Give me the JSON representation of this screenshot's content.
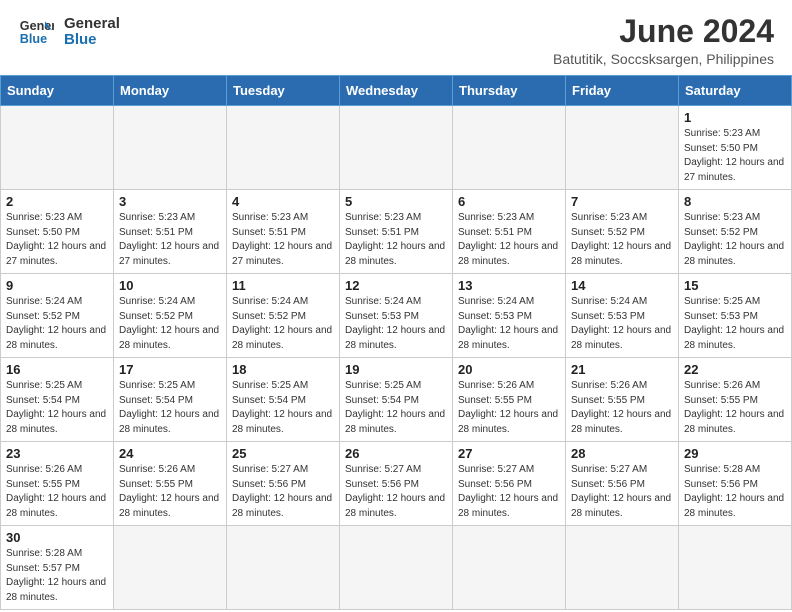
{
  "header": {
    "logo_line1": "General",
    "logo_line2": "Blue",
    "month_title": "June 2024",
    "location": "Batutitik, Soccsksargen, Philippines"
  },
  "days_of_week": [
    "Sunday",
    "Monday",
    "Tuesday",
    "Wednesday",
    "Thursday",
    "Friday",
    "Saturday"
  ],
  "weeks": [
    [
      {
        "day": null
      },
      {
        "day": null
      },
      {
        "day": null
      },
      {
        "day": null
      },
      {
        "day": null
      },
      {
        "day": null
      },
      {
        "day": 1,
        "sunrise": "5:23 AM",
        "sunset": "5:50 PM",
        "daylight": "12 hours and 27 minutes."
      }
    ],
    [
      {
        "day": 2,
        "sunrise": "5:23 AM",
        "sunset": "5:50 PM",
        "daylight": "12 hours and 27 minutes."
      },
      {
        "day": 3,
        "sunrise": "5:23 AM",
        "sunset": "5:51 PM",
        "daylight": "12 hours and 27 minutes."
      },
      {
        "day": 4,
        "sunrise": "5:23 AM",
        "sunset": "5:51 PM",
        "daylight": "12 hours and 27 minutes."
      },
      {
        "day": 5,
        "sunrise": "5:23 AM",
        "sunset": "5:51 PM",
        "daylight": "12 hours and 28 minutes."
      },
      {
        "day": 6,
        "sunrise": "5:23 AM",
        "sunset": "5:51 PM",
        "daylight": "12 hours and 28 minutes."
      },
      {
        "day": 7,
        "sunrise": "5:23 AM",
        "sunset": "5:52 PM",
        "daylight": "12 hours and 28 minutes."
      },
      {
        "day": 8,
        "sunrise": "5:23 AM",
        "sunset": "5:52 PM",
        "daylight": "12 hours and 28 minutes."
      }
    ],
    [
      {
        "day": 9,
        "sunrise": "5:24 AM",
        "sunset": "5:52 PM",
        "daylight": "12 hours and 28 minutes."
      },
      {
        "day": 10,
        "sunrise": "5:24 AM",
        "sunset": "5:52 PM",
        "daylight": "12 hours and 28 minutes."
      },
      {
        "day": 11,
        "sunrise": "5:24 AM",
        "sunset": "5:52 PM",
        "daylight": "12 hours and 28 minutes."
      },
      {
        "day": 12,
        "sunrise": "5:24 AM",
        "sunset": "5:53 PM",
        "daylight": "12 hours and 28 minutes."
      },
      {
        "day": 13,
        "sunrise": "5:24 AM",
        "sunset": "5:53 PM",
        "daylight": "12 hours and 28 minutes."
      },
      {
        "day": 14,
        "sunrise": "5:24 AM",
        "sunset": "5:53 PM",
        "daylight": "12 hours and 28 minutes."
      },
      {
        "day": 15,
        "sunrise": "5:25 AM",
        "sunset": "5:53 PM",
        "daylight": "12 hours and 28 minutes."
      }
    ],
    [
      {
        "day": 16,
        "sunrise": "5:25 AM",
        "sunset": "5:54 PM",
        "daylight": "12 hours and 28 minutes."
      },
      {
        "day": 17,
        "sunrise": "5:25 AM",
        "sunset": "5:54 PM",
        "daylight": "12 hours and 28 minutes."
      },
      {
        "day": 18,
        "sunrise": "5:25 AM",
        "sunset": "5:54 PM",
        "daylight": "12 hours and 28 minutes."
      },
      {
        "day": 19,
        "sunrise": "5:25 AM",
        "sunset": "5:54 PM",
        "daylight": "12 hours and 28 minutes."
      },
      {
        "day": 20,
        "sunrise": "5:26 AM",
        "sunset": "5:55 PM",
        "daylight": "12 hours and 28 minutes."
      },
      {
        "day": 21,
        "sunrise": "5:26 AM",
        "sunset": "5:55 PM",
        "daylight": "12 hours and 28 minutes."
      },
      {
        "day": 22,
        "sunrise": "5:26 AM",
        "sunset": "5:55 PM",
        "daylight": "12 hours and 28 minutes."
      }
    ],
    [
      {
        "day": 23,
        "sunrise": "5:26 AM",
        "sunset": "5:55 PM",
        "daylight": "12 hours and 28 minutes."
      },
      {
        "day": 24,
        "sunrise": "5:26 AM",
        "sunset": "5:55 PM",
        "daylight": "12 hours and 28 minutes."
      },
      {
        "day": 25,
        "sunrise": "5:27 AM",
        "sunset": "5:56 PM",
        "daylight": "12 hours and 28 minutes."
      },
      {
        "day": 26,
        "sunrise": "5:27 AM",
        "sunset": "5:56 PM",
        "daylight": "12 hours and 28 minutes."
      },
      {
        "day": 27,
        "sunrise": "5:27 AM",
        "sunset": "5:56 PM",
        "daylight": "12 hours and 28 minutes."
      },
      {
        "day": 28,
        "sunrise": "5:27 AM",
        "sunset": "5:56 PM",
        "daylight": "12 hours and 28 minutes."
      },
      {
        "day": 29,
        "sunrise": "5:28 AM",
        "sunset": "5:56 PM",
        "daylight": "12 hours and 28 minutes."
      }
    ],
    [
      {
        "day": 30,
        "sunrise": "5:28 AM",
        "sunset": "5:57 PM",
        "daylight": "12 hours and 28 minutes."
      },
      {
        "day": null
      },
      {
        "day": null
      },
      {
        "day": null
      },
      {
        "day": null
      },
      {
        "day": null
      },
      {
        "day": null
      }
    ]
  ]
}
